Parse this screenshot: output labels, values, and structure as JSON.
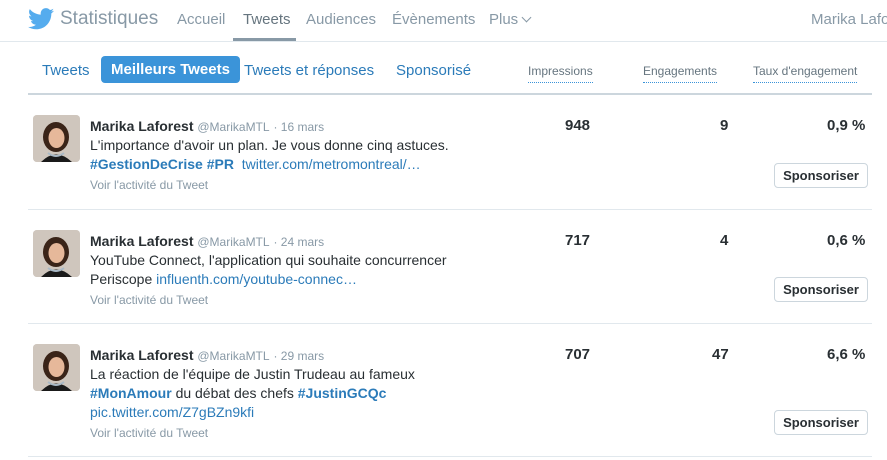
{
  "nav": {
    "brand": "Statistiques",
    "items": [
      "Accueil",
      "Tweets",
      "Audiences",
      "Évènements",
      "Plus"
    ],
    "active": "Tweets",
    "user": "Marika Lafor"
  },
  "tabs": [
    "Tweets",
    "Meilleurs Tweets",
    "Tweets et réponses",
    "Sponsorisé"
  ],
  "active_tab": "Meilleurs Tweets",
  "columns": [
    "Impressions",
    "Engagements",
    "Taux d'engagement"
  ],
  "rows": [
    {
      "name": "Marika Laforest",
      "handle": "@MarikaMTL",
      "date": "· 16 mars",
      "line1": "L'importance d'avoir un plan. Je vous donne cinq astuces.",
      "tags1": "#GestionDeCrise #PR",
      "link1": "twitter.com/metromontreal/…",
      "activity": "Voir l'activité du Tweet",
      "impressions": "948",
      "engagements": "9",
      "rate": "0,9 %",
      "sponsor": "Sponsoriser"
    },
    {
      "name": "Marika Laforest",
      "handle": "@MarikaMTL",
      "date": "· 24 mars",
      "line1": "YouTube Connect, l'application qui souhaite concurrencer",
      "line2": "Periscope",
      "link1": "influenth.com/youtube-connec…",
      "activity": "Voir l'activité du Tweet",
      "impressions": "717",
      "engagements": "4",
      "rate": "0,6 %",
      "sponsor": "Sponsoriser"
    },
    {
      "name": "Marika Laforest",
      "handle": "@MarikaMTL",
      "date": "· 29 mars",
      "line1": "La réaction de l'équipe de Justin Trudeau au fameux",
      "tag_a": "#MonAmour",
      "mid": "du débat des chefs",
      "tag_b": "#JustinGCQc",
      "link1": "pic.twitter.com/Z7gBZn9kfi",
      "activity": "Voir l'activité du Tweet",
      "impressions": "707",
      "engagements": "47",
      "rate": "6,6 %",
      "sponsor": "Sponsoriser"
    }
  ],
  "colors": {
    "accent": "#3b94d9",
    "link": "#2b7bb9",
    "muted": "#8899a6"
  }
}
